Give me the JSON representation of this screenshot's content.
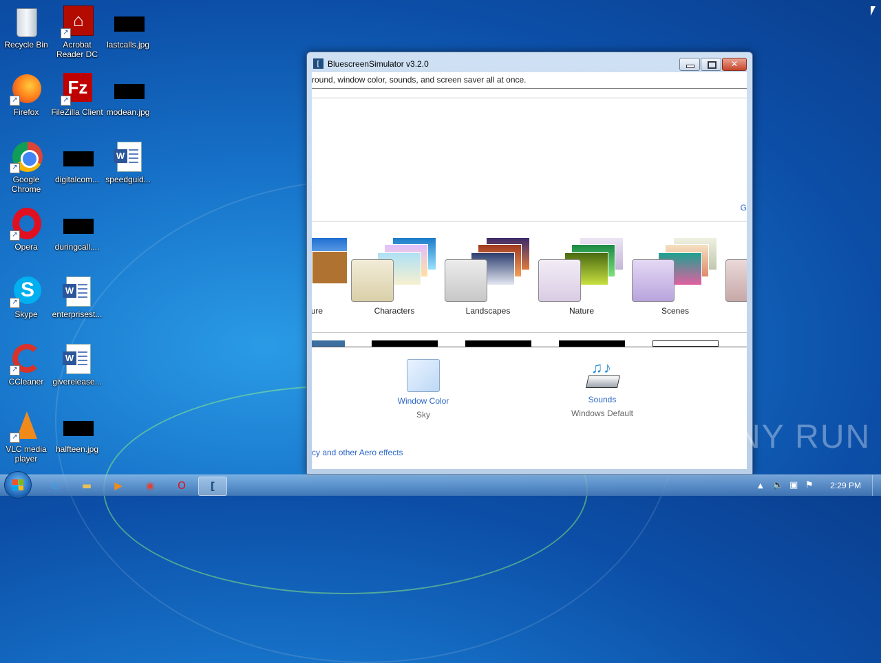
{
  "desktop": {
    "icons": [
      {
        "label": "Recycle Bin",
        "icon": "recycle-bin-icon"
      },
      {
        "label": "Acrobat Reader DC",
        "icon": "acrobat-icon"
      },
      {
        "label": "lastcalls.jpg",
        "icon": "image-file-icon"
      },
      {
        "label": "Firefox",
        "icon": "firefox-icon"
      },
      {
        "label": "FileZilla Client",
        "icon": "filezilla-icon"
      },
      {
        "label": "modean.jpg",
        "icon": "image-file-icon"
      },
      {
        "label": "Google Chrome",
        "icon": "chrome-icon"
      },
      {
        "label": "digitalcom...",
        "icon": "image-file-icon"
      },
      {
        "label": "speedguid...",
        "icon": "word-doc-icon"
      },
      {
        "label": "Opera",
        "icon": "opera-icon"
      },
      {
        "label": "duringcall....",
        "icon": "image-file-icon"
      },
      {
        "label": "Skype",
        "icon": "skype-icon"
      },
      {
        "label": "enterprisest...",
        "icon": "word-doc-icon"
      },
      {
        "label": "CCleaner",
        "icon": "ccleaner-icon"
      },
      {
        "label": "giverelease...",
        "icon": "word-doc-icon"
      },
      {
        "label": "VLC media player",
        "icon": "vlc-icon"
      },
      {
        "label": "halfteen.jpg",
        "icon": "image-file-icon"
      }
    ]
  },
  "window": {
    "title": "BluescreenSimulator v3.2.0",
    "description": "round, window color, sounds, and screen saver all at once.",
    "side_link": "G",
    "themes": [
      {
        "label": "ure"
      },
      {
        "label": "Characters"
      },
      {
        "label": "Landscapes"
      },
      {
        "label": "Nature"
      },
      {
        "label": "Scenes"
      }
    ],
    "window_color": {
      "label": "Window Color",
      "value": "Sky"
    },
    "sounds": {
      "label": "Sounds",
      "value": "Windows Default"
    },
    "aero_link": "cy and other Aero effects"
  },
  "taskbar": {
    "clock": "2:29 PM"
  },
  "watermark": "ANY RUN",
  "colors": {
    "accent": "#2b66c7",
    "taskbar": "#4a7fbf"
  }
}
